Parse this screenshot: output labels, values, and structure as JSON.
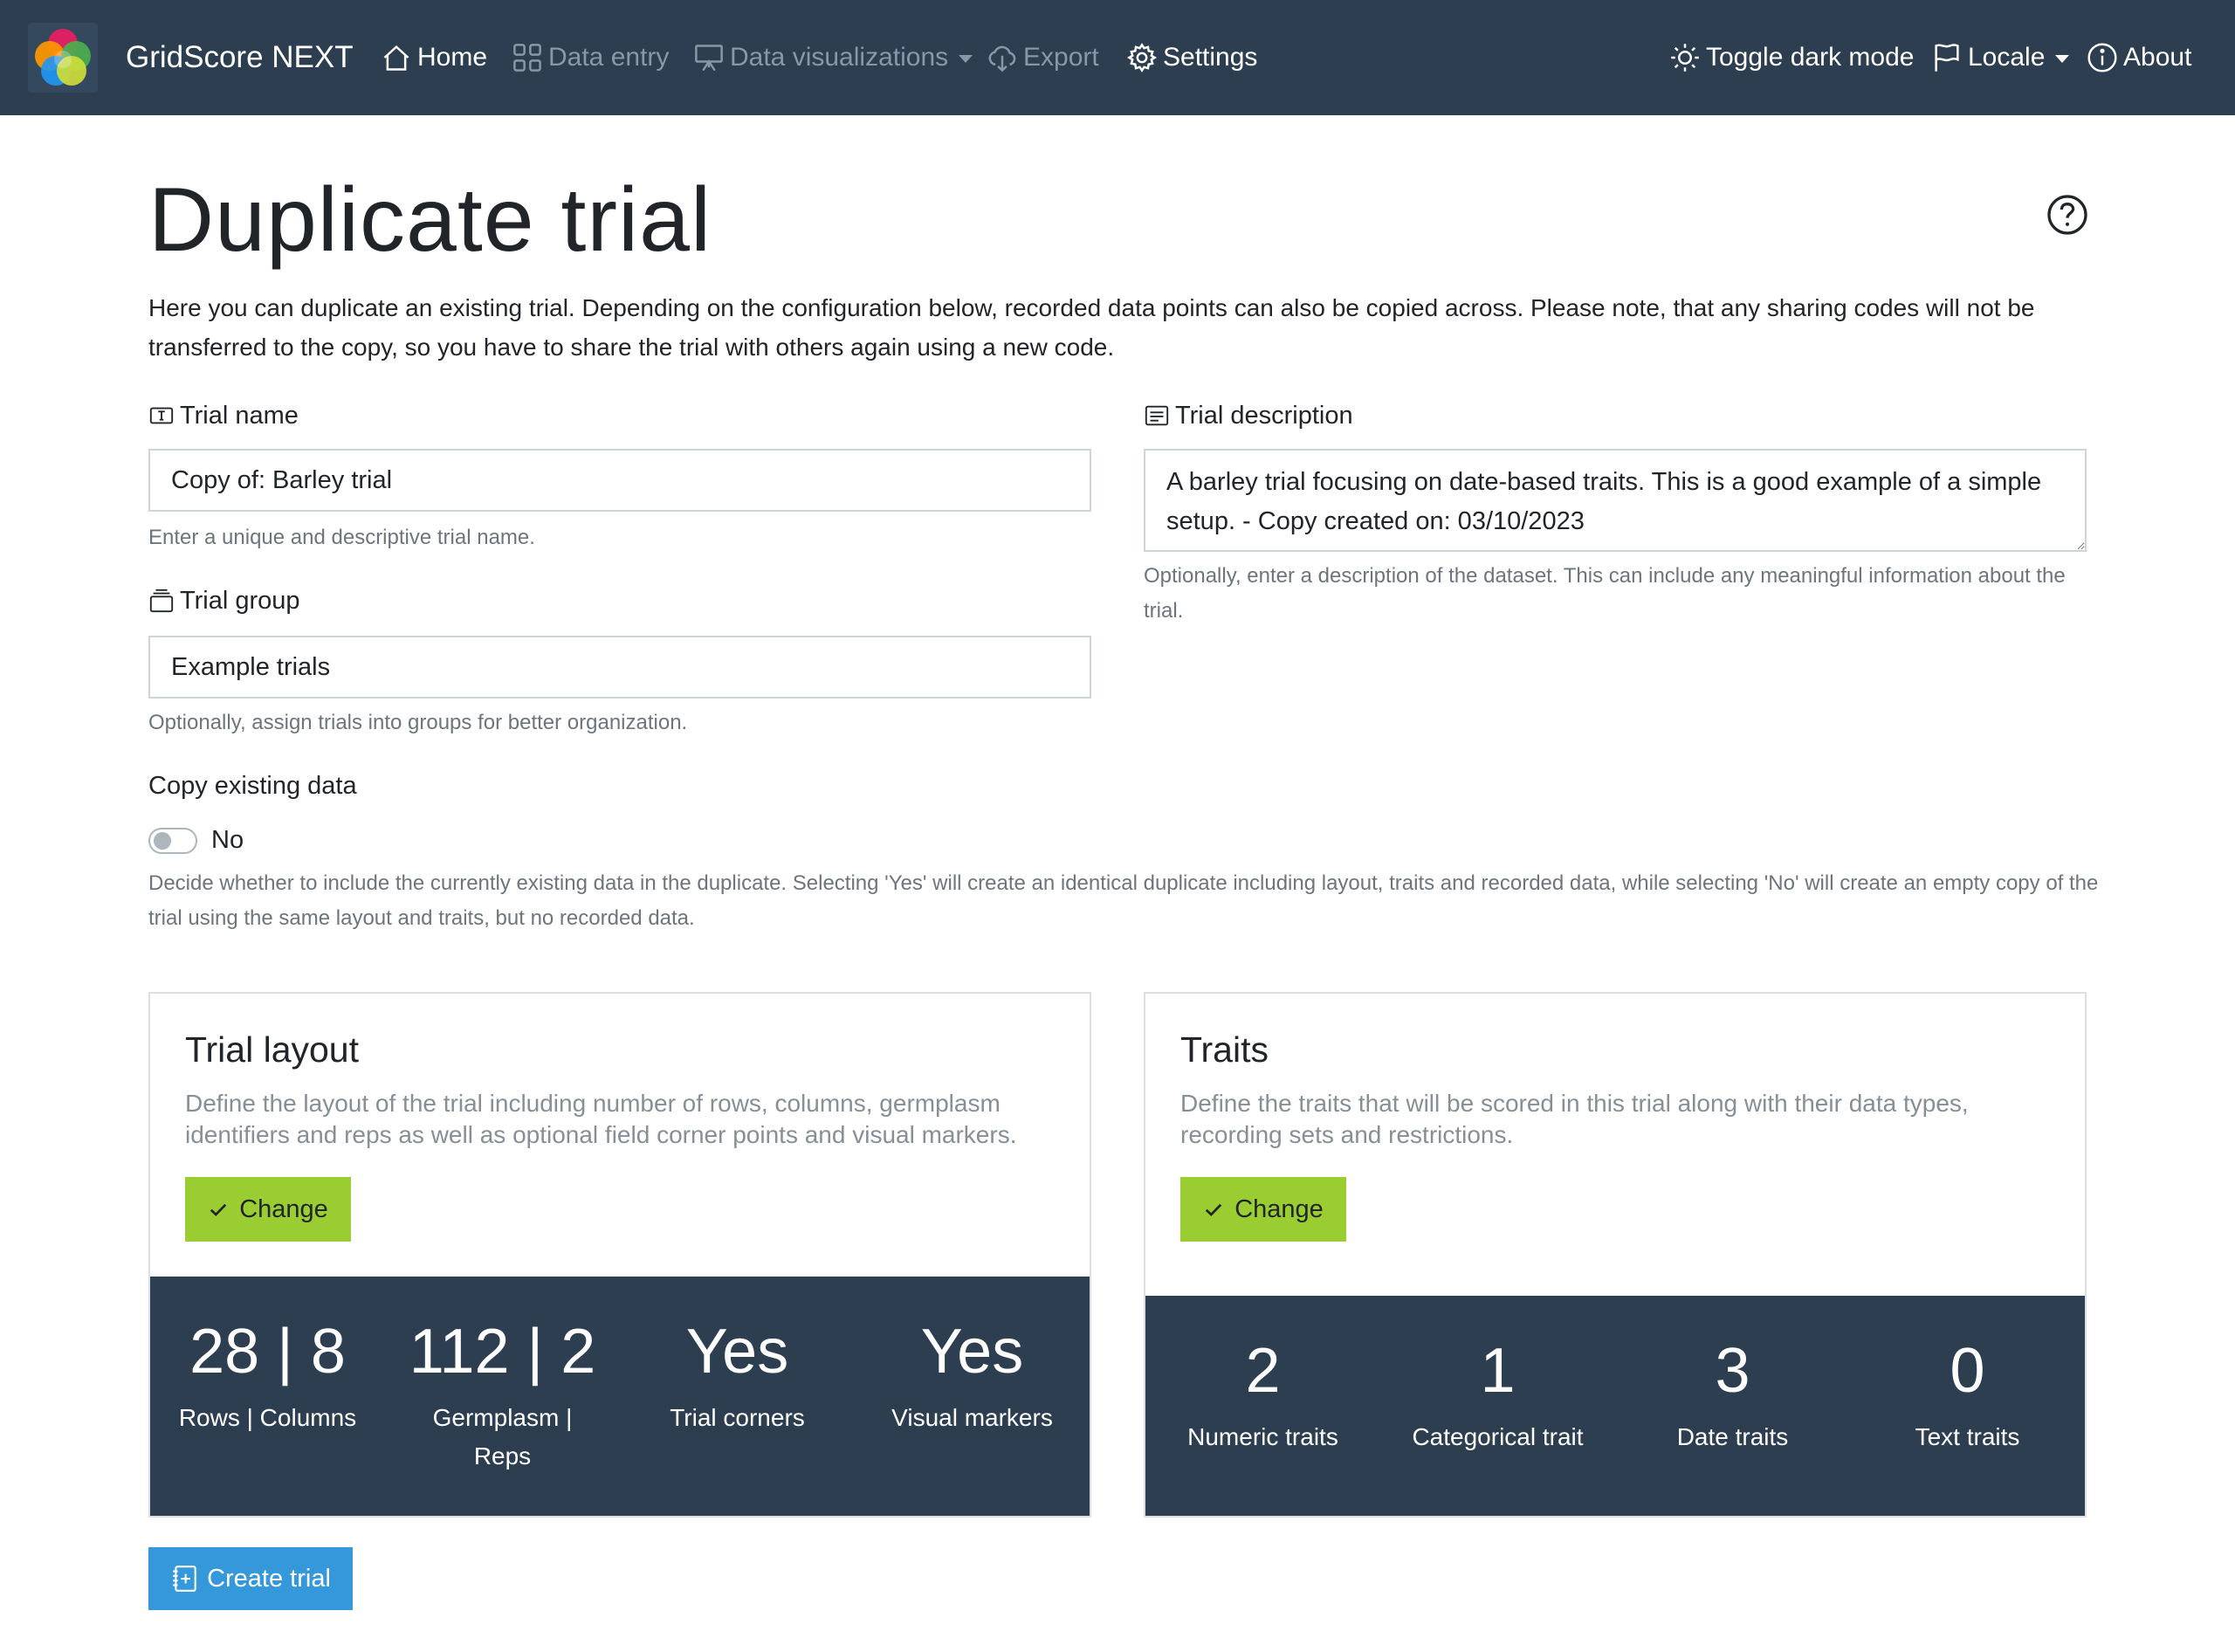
{
  "navbar": {
    "brand": "GridScore NEXT",
    "items": [
      {
        "label": "Home",
        "icon": "house-icon"
      },
      {
        "label": "Data entry",
        "icon": "grid-icon"
      },
      {
        "label": "Data visualizations",
        "icon": "easel-icon"
      },
      {
        "label": "Export",
        "icon": "cloud-download-icon"
      },
      {
        "label": "Settings",
        "icon": "gear-icon"
      }
    ],
    "right_items": [
      {
        "label": "Toggle dark mode",
        "icon": "sun-icon"
      },
      {
        "label": "Locale",
        "icon": "flag-icon"
      },
      {
        "label": "About",
        "icon": "info-icon"
      }
    ]
  },
  "page": {
    "title": "Duplicate trial",
    "intro": "Here you can duplicate an existing trial. Depending on the configuration below, recorded data points can also be copied across. Please note, that any sharing codes will not be transferred to the copy, so you have to share the trial with others again using a new code."
  },
  "form": {
    "trial_name": {
      "label": "Trial name",
      "value": "Copy of: Barley trial",
      "help": "Enter a unique and descriptive trial name."
    },
    "trial_group": {
      "label": "Trial group",
      "value": "Example trials",
      "help": "Optionally, assign trials into groups for better organization."
    },
    "trial_description": {
      "label": "Trial description",
      "value": "A barley trial focusing on date-based traits. This is a good example of a simple setup. - Copy created on: 03/10/2023",
      "help": "Optionally, enter a description of the dataset. This can include any meaningful information about the trial."
    },
    "copy_data": {
      "label": "Copy existing data",
      "state": "No",
      "help": "Decide whether to include the currently existing data in the duplicate. Selecting 'Yes' will create an identical duplicate including layout, traits and recorded data, while selecting 'No' will create an empty copy of the trial using the same layout and traits, but no recorded data."
    }
  },
  "layout_card": {
    "title": "Trial layout",
    "description": "Define the layout of the trial including number of rows, columns, germplasm identifiers and reps as well as optional field corner points and visual markers.",
    "button": "Change",
    "stats": [
      {
        "value": "28 | 8",
        "label": "Rows | Columns"
      },
      {
        "value": "112 | 2",
        "label": "Germplasm | Reps"
      },
      {
        "value": "Yes",
        "label": "Trial corners"
      },
      {
        "value": "Yes",
        "label": "Visual markers"
      }
    ]
  },
  "traits_card": {
    "title": "Traits",
    "description": "Define the traits that will be scored in this trial along with their data types, recording sets and restrictions.",
    "button": "Change",
    "stats": [
      {
        "value": "2",
        "label": "Numeric traits"
      },
      {
        "value": "1",
        "label": "Categorical trait"
      },
      {
        "value": "3",
        "label": "Date traits"
      },
      {
        "value": "0",
        "label": "Text traits"
      }
    ]
  },
  "actions": {
    "create": "Create trial"
  },
  "colors": {
    "navbar": "#2c3e50",
    "success": "#9acd32",
    "primary": "#3498db"
  }
}
